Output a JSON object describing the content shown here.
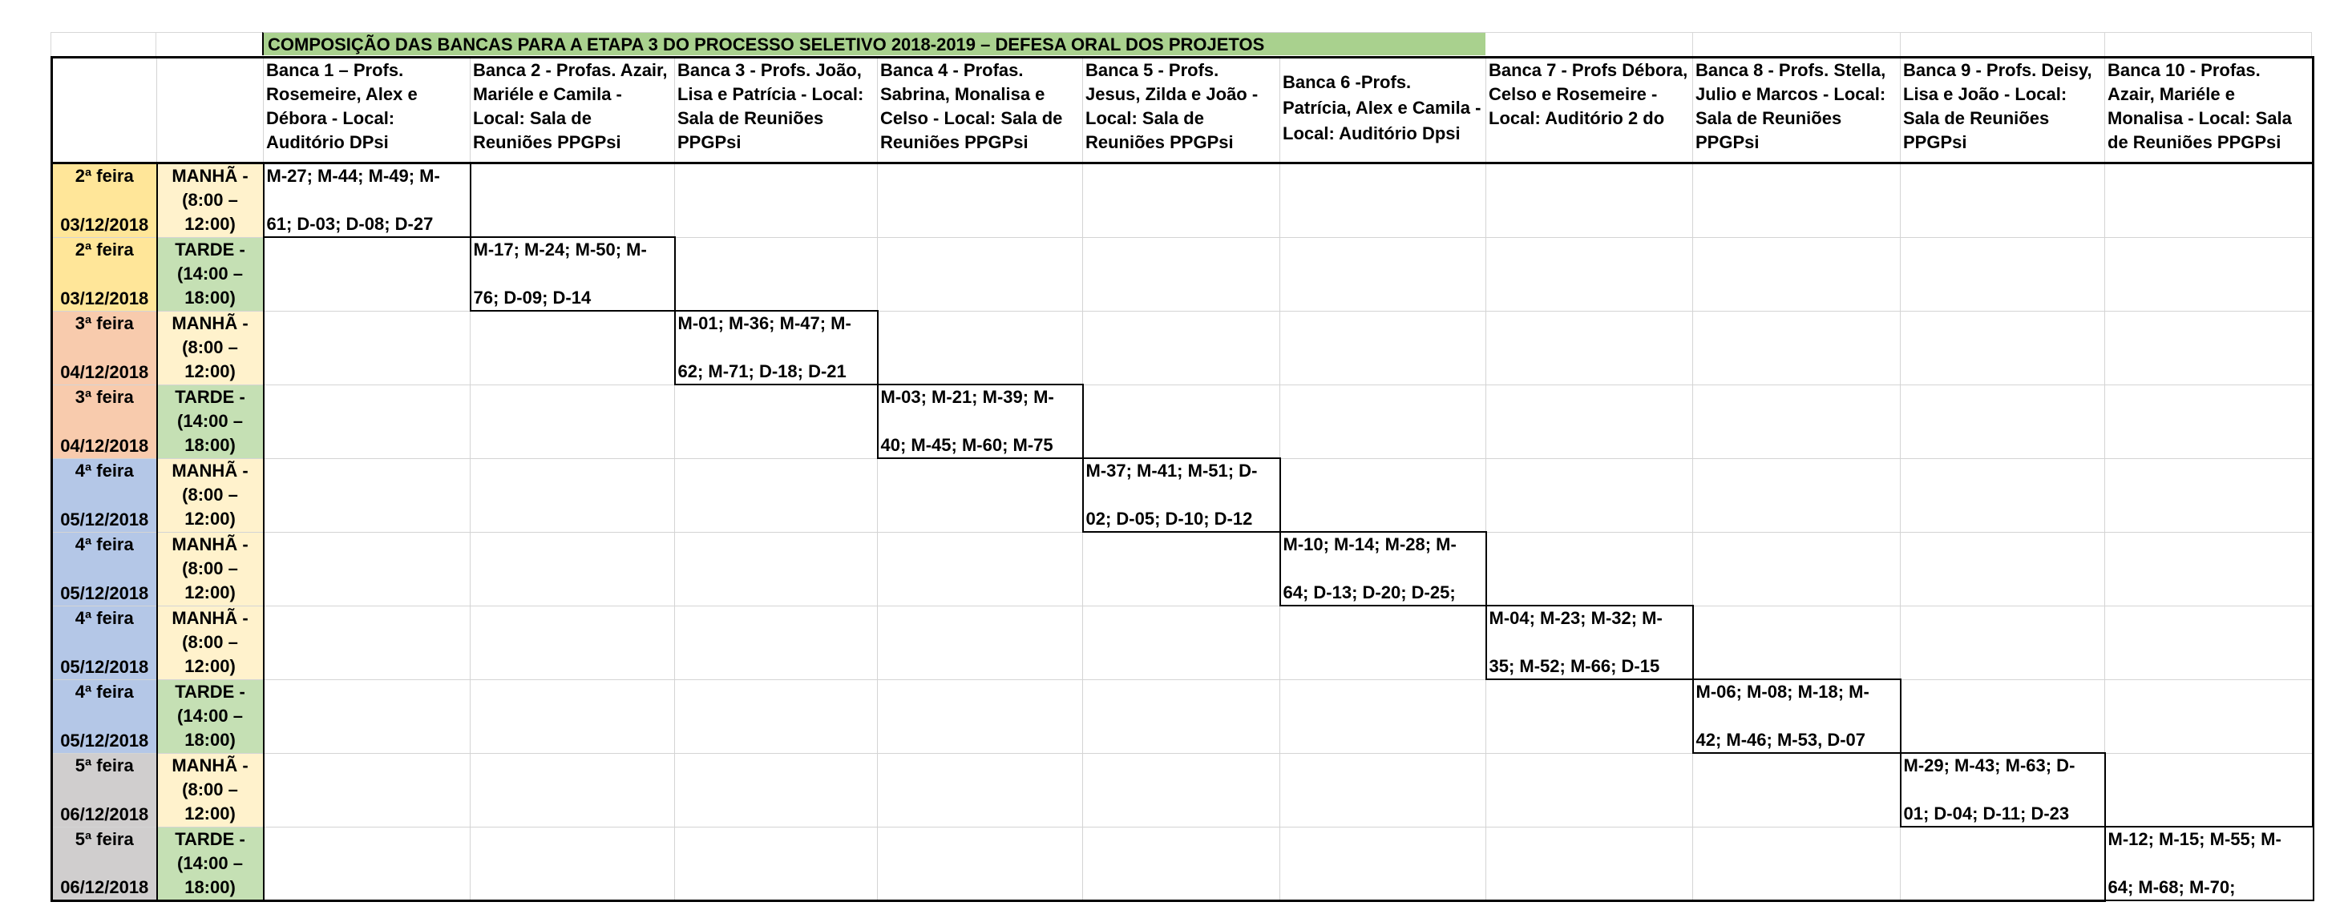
{
  "title": "COMPOSIÇÃO DAS BANCAS PARA A ETAPA 3 DO PROCESSO SELETIVO 2018-2019 – DEFESA ORAL DOS PROJETOS",
  "bancas": [
    "Banca 1 – Profs. Rosemeire, Alex e Débora - Local: Auditório DPsi",
    "Banca 2 - Profas. Azair, Mariéle e Camila - Local: Sala de Reuniões PPGPsi",
    "Banca 3 - Profs. João, Lisa e Patrícia - Local: Sala de Reuniões PPGPsi",
    "Banca 4 - Profas. Sabrina, Monalisa e Celso - Local: Sala de Reuniões PPGPsi",
    "Banca 5  - Profs. Jesus, Zilda e João  - Local: Sala de Reuniões PPGPsi",
    "Banca 6 -Profs. Patrícia, Alex e Camila - Local: Auditório Dpsi",
    "Banca 7  - Profs Débora, Celso e Rosemeire - Local: Auditório 2  do",
    "Banca 8  - Profs. Stella, Julio e Marcos  - Local: Sala de Reuniões PPGPsi",
    "Banca 9  - Profs. Deisy, Lisa e João  - Local: Sala de Reuniões PPGPsi",
    "Banca 10  - Profas. Azair, Mariéle e Monalisa  - Local: Sala de Reuniões PPGPsi"
  ],
  "rows": [
    {
      "day": "2ª feira",
      "date": "03/12/2018",
      "shift": "MANHÃ - (8:00 – 12:00)",
      "line1": "M-27; M-44;  M-49; M-",
      "line2": "61; D-03; D-08; D-27"
    },
    {
      "day": "2ª feira",
      "date": "03/12/2018",
      "shift": "TARDE - (14:00 – 18:00)",
      "line1": "M-17; M-24; M-50; M-",
      "line2": "76; D-09; D-14"
    },
    {
      "day": "3ª feira",
      "date": "04/12/2018",
      "shift": "MANHÃ - (8:00 – 12:00)",
      "line1": "M-01; M-36; M-47; M-",
      "line2": "62; M-71; D-18; D-21"
    },
    {
      "day": "3ª feira",
      "date": "04/12/2018",
      "shift": "TARDE - (14:00 – 18:00)",
      "line1": "M-03; M-21; M-39; M-",
      "line2": "40; M-45; M-60; M-75"
    },
    {
      "day": "4ª feira",
      "date": "05/12/2018",
      "shift": "MANHÃ - (8:00 – 12:00)",
      "line1": "M-37; M-41; M-51; D-",
      "line2": "02; D-05; D-10;  D-12"
    },
    {
      "day": "4ª feira",
      "date": "05/12/2018",
      "shift": "MANHÃ - (8:00 – 12:00)",
      "line1": "M-10;  M-14; M-28; M-",
      "line2": "64; D-13; D-20; D-25;"
    },
    {
      "day": "4ª feira",
      "date": "05/12/2018",
      "shift": "MANHÃ - (8:00 – 12:00)",
      "line1": "M-04; M-23; M-32; M-",
      "line2": "35; M-52; M-66; D-15"
    },
    {
      "day": "4ª feira",
      "date": "05/12/2018",
      "shift": "TARDE - (14:00 – 18:00)",
      "line1": "M-06; M-08; M-18;  M-",
      "line2": "42; M-46; M-53, D-07"
    },
    {
      "day": "5ª feira",
      "date": "06/12/2018",
      "shift": "MANHÃ - (8:00 – 12:00)",
      "line1": "M-29; M-43; M-63; D-",
      "line2": "01; D-04; D-11; D-23"
    },
    {
      "day": "5ª feira",
      "date": "06/12/2018",
      "shift": "TARDE - (14:00 – 18:00)",
      "line1": "M-12; M-15; M-55;  M-",
      "line2": "64; M-68;  M-70;"
    }
  ]
}
